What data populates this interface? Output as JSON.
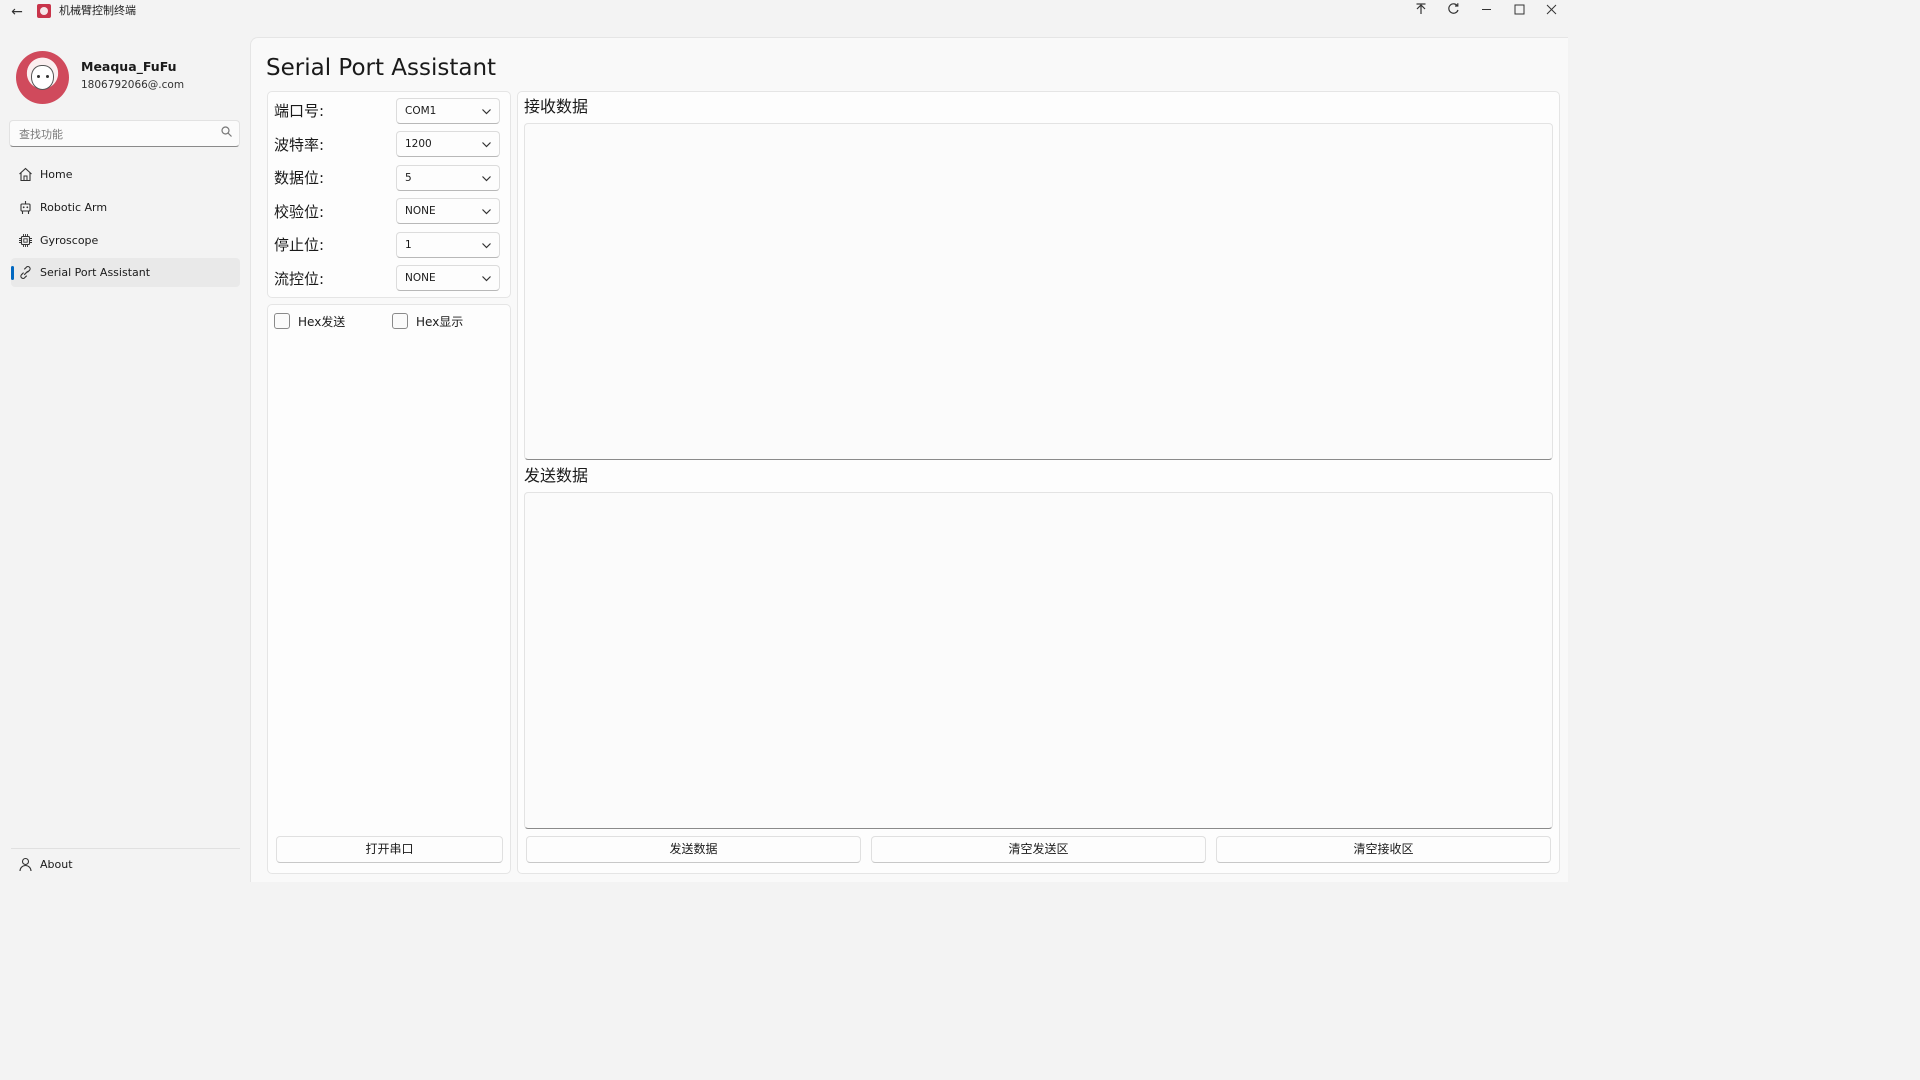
{
  "window": {
    "title": "机械臂控制终端"
  },
  "user": {
    "name": "Meaqua_FuFu",
    "email": "1806792066@.com"
  },
  "search": {
    "placeholder": "查找功能"
  },
  "nav": {
    "items": [
      {
        "label": "Home",
        "icon": "home-icon"
      },
      {
        "label": "Robotic Arm",
        "icon": "robot-icon"
      },
      {
        "label": "Gyroscope",
        "icon": "chip-icon"
      },
      {
        "label": "Serial Port Assistant",
        "icon": "link-icon",
        "active": true
      }
    ],
    "footer": {
      "label": "About",
      "icon": "person-icon"
    }
  },
  "page": {
    "title": "Serial Port Assistant"
  },
  "settings": {
    "port_label": "端口号:",
    "port_value": "COM1",
    "baud_label": "波特率:",
    "baud_value": "1200",
    "databits_label": "数据位:",
    "databits_value": "5",
    "parity_label": "校验位:",
    "parity_value": "NONE",
    "stopbits_label": "停止位:",
    "stopbits_value": "1",
    "flow_label": "流控位:",
    "flow_value": "NONE"
  },
  "options": {
    "hex_send_label": "Hex发送",
    "hex_send_checked": false,
    "hex_display_label": "Hex显示",
    "hex_display_checked": false,
    "open_port_label": "打开串口"
  },
  "receive": {
    "label": "接收数据",
    "content": ""
  },
  "send": {
    "label": "发送数据",
    "content": ""
  },
  "actions": {
    "send_label": "发送数据",
    "clear_send_label": "清空发送区",
    "clear_receive_label": "清空接收区"
  },
  "colors": {
    "accent": "#0067c0",
    "window_bg": "#f3f3f3",
    "content_bg": "#f9f9f9"
  }
}
